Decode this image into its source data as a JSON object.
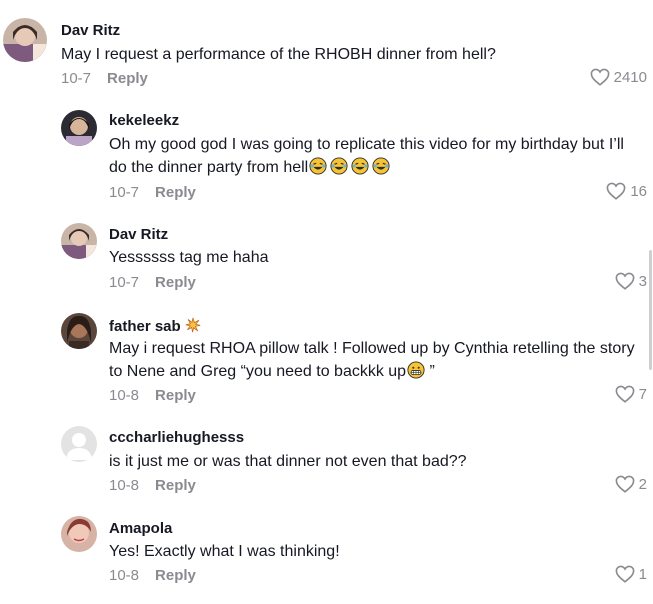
{
  "comments": [
    {
      "username": "Dav Ritz",
      "text": "May I request a performance of the RHOBH dinner from hell?",
      "date": "10-7",
      "reply_label": "Reply",
      "likes": "2410"
    },
    {
      "username": "kekeleekz",
      "text_line1": "Oh my good god I was going to replicate this video for my birthday but I’ll",
      "text_line2": "do the dinner party from hell",
      "emoji": "laughing-crying-emoji",
      "date": "10-7",
      "reply_label": "Reply",
      "likes": "16"
    },
    {
      "username": "Dav Ritz",
      "text": "Yessssss tag me haha",
      "date": "10-7",
      "reply_label": "Reply",
      "likes": "3"
    },
    {
      "username": "father sab",
      "badge": "sparkle-burst-emoji",
      "text_line1": "May i request RHOA pillow talk ! Followed up by Cynthia retelling the story",
      "text_line2a": "to Nene and Greg “you need to backkk up",
      "text_line2b": " ”",
      "date": "10-8",
      "reply_label": "Reply",
      "likes": "7"
    },
    {
      "username": "cccharliehughesss",
      "text": "is it just me or was that dinner not even that bad??",
      "date": "10-8",
      "reply_label": "Reply",
      "likes": "2"
    },
    {
      "username": "Amapola",
      "text": "Yes! Exactly what I was thinking!",
      "date": "10-8",
      "reply_label": "Reply",
      "likes": "1"
    }
  ],
  "colors": {
    "text": "#161823",
    "muted": "#8a8b91",
    "background": "#ffffff"
  },
  "icons": {
    "like": "heart-outline-icon",
    "default_avatar": "default-avatar-icon"
  }
}
